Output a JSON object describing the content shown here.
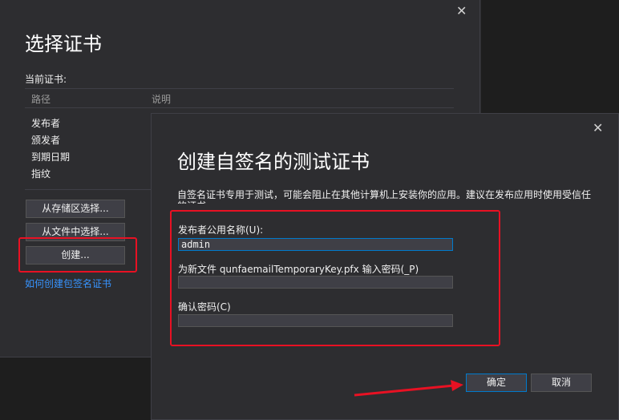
{
  "back_dialog": {
    "title": "选择证书",
    "current_cert_label": "当前证书:",
    "columns": [
      "路径",
      "说明"
    ],
    "rows": [
      "发布者",
      "颁发者",
      "到期日期",
      "指纹"
    ],
    "btn_store": "从存储区选择...",
    "btn_file": "从文件中选择...",
    "btn_create": "创建...",
    "link_help": "如何创建包签名证书",
    "close_glyph": "✕"
  },
  "front_dialog": {
    "title": "创建自签名的测试证书",
    "description": "自签名证书专用于测试，可能会阻止在其他计算机上安装你的应用。建议在发布应用时使用受信任的证书。",
    "publisher_label": "发布者公用名称(U):",
    "publisher_value": "admin",
    "password_label": "为新文件 qunfaemailTemporaryKey.pfx 输入密码(_P)",
    "password_value": "",
    "confirm_label": "确认密码(C)",
    "confirm_value": "",
    "ok_label": "确定",
    "cancel_label": "取消",
    "close_glyph": "✕"
  },
  "annotations": {
    "highlight_color": "#e81123"
  }
}
